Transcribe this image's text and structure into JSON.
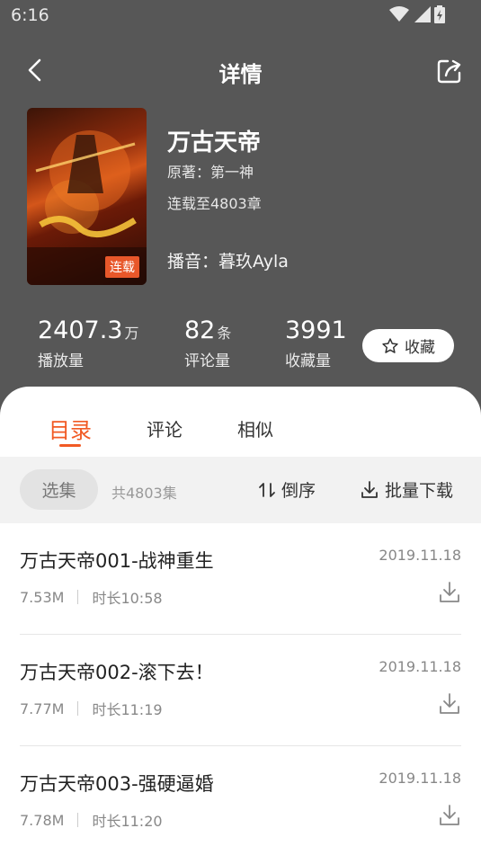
{
  "status_bar": {
    "time": "6:16"
  },
  "nav": {
    "title": "详情"
  },
  "book": {
    "cover_badge": "连载",
    "title": "万古天帝",
    "author": "原著：第一神",
    "progress": "连载至4803章",
    "narrator": "播音：暮玖Ayla"
  },
  "stats": {
    "plays": {
      "value": "2407.3",
      "unit": "万",
      "label": "播放量"
    },
    "comments": {
      "value": "82",
      "unit": "条",
      "label": "评论量"
    },
    "favorites": {
      "value": "3991",
      "unit": "",
      "label": "收藏量"
    }
  },
  "favorite_button": {
    "label": "收藏"
  },
  "tabs": [
    {
      "label": "目录",
      "active": true
    },
    {
      "label": "评论",
      "active": false
    },
    {
      "label": "相似",
      "active": false
    }
  ],
  "toolbar": {
    "select_label": "选集",
    "total": "共4803集",
    "sort_label": "倒序",
    "batch_download_label": "批量下载"
  },
  "episodes": [
    {
      "title": "万古天帝001-战神重生",
      "date": "2019.11.18",
      "size": "7.53M",
      "duration": "时长10:58"
    },
    {
      "title": "万古天帝002-滚下去！",
      "date": "2019.11.18",
      "size": "7.77M",
      "duration": "时长11:19"
    },
    {
      "title": "万古天帝003-强硬逼婚",
      "date": "2019.11.18",
      "size": "7.78M",
      "duration": "时长11:20"
    }
  ],
  "colors": {
    "accent": "#f15a24",
    "header_bg": "#575757"
  }
}
